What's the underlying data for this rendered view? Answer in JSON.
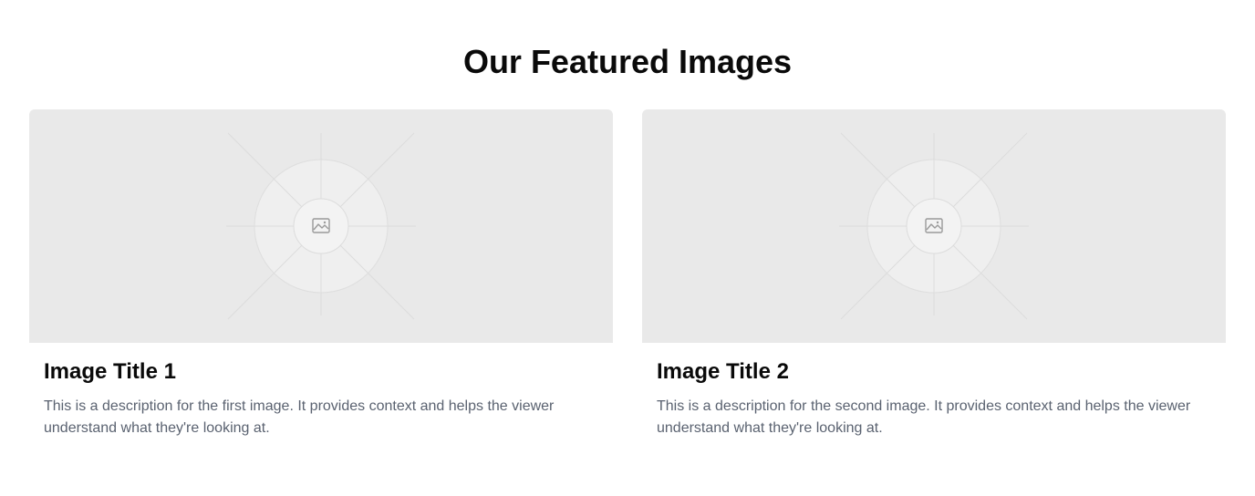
{
  "section": {
    "heading": "Our Featured Images"
  },
  "cards": [
    {
      "title": "Image Title 1",
      "description": "This is a description for the first image. It provides context and helps the viewer understand what they're looking at.",
      "icon": "image-placeholder-icon"
    },
    {
      "title": "Image Title 2",
      "description": "This is a description for the second image. It provides context and helps the viewer understand what they're looking at.",
      "icon": "image-placeholder-icon"
    }
  ],
  "colors": {
    "placeholder_bg": "#e9e9e9",
    "heading": "#0a0a0a",
    "description": "#5a6270"
  }
}
